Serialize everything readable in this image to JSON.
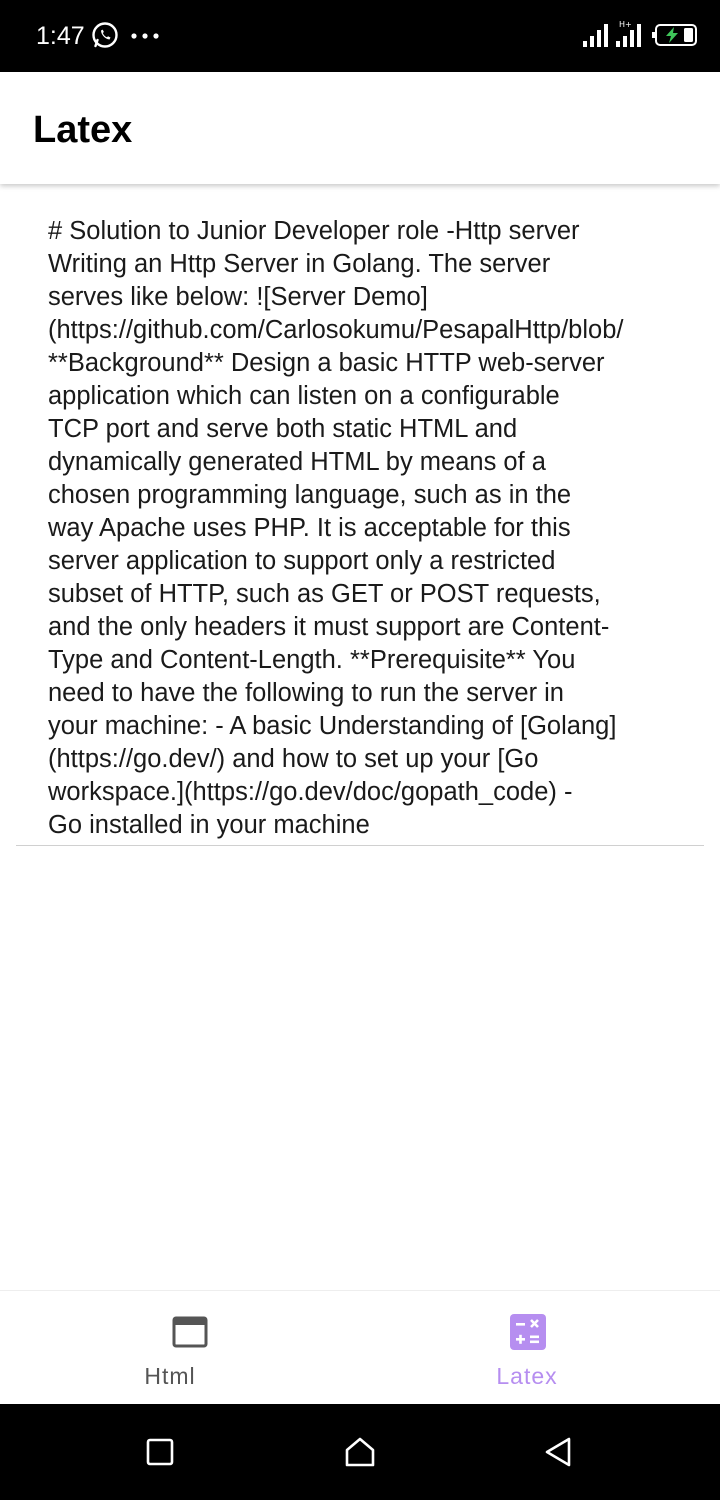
{
  "status_bar": {
    "time": "1:47",
    "icons": [
      "whatsapp-icon",
      "more-dots-icon",
      "signal-icon",
      "signal-icon",
      "battery-charging-icon"
    ]
  },
  "app_bar": {
    "title": "Latex"
  },
  "content": {
    "lines": [
      "# Solution to Junior Developer role -Http server",
      "Writing an Http Server in Golang. The server",
      "serves like below: ![Server Demo]",
      "(https://github.com/Carlosokumu/PesapalHttp/blob/",
      "**Background** Design a basic HTTP web-server",
      "application which can listen on a configurable",
      "TCP port and serve both static HTML and",
      "dynamically generated HTML by means of a",
      "chosen programming language, such as in the",
      "way Apache uses PHP. It is acceptable for this",
      "server application to support only a restricted",
      "subset of HTTP, such as GET or POST requests,",
      "and the only headers it must support are Content-",
      "Type and Content-Length. **Prerequisite** You",
      "need to have the following to run the server in",
      "your machine: - A basic Understanding of [Golang]",
      "(https://go.dev/) and how to set up your [Go",
      "workspace.](https://go.dev/doc/gopath_code) -",
      "Go installed in your machine"
    ]
  },
  "bottom_nav": {
    "items": [
      {
        "label": "Html",
        "icon": "browser-window-icon",
        "selected": false
      },
      {
        "label": "Latex",
        "icon": "calculator-icon",
        "selected": true
      }
    ],
    "selected_color": "#b68ef0",
    "unselected_color": "#555555"
  },
  "system_nav": {
    "buttons": [
      "back-icon",
      "home-icon",
      "recents-icon"
    ]
  }
}
